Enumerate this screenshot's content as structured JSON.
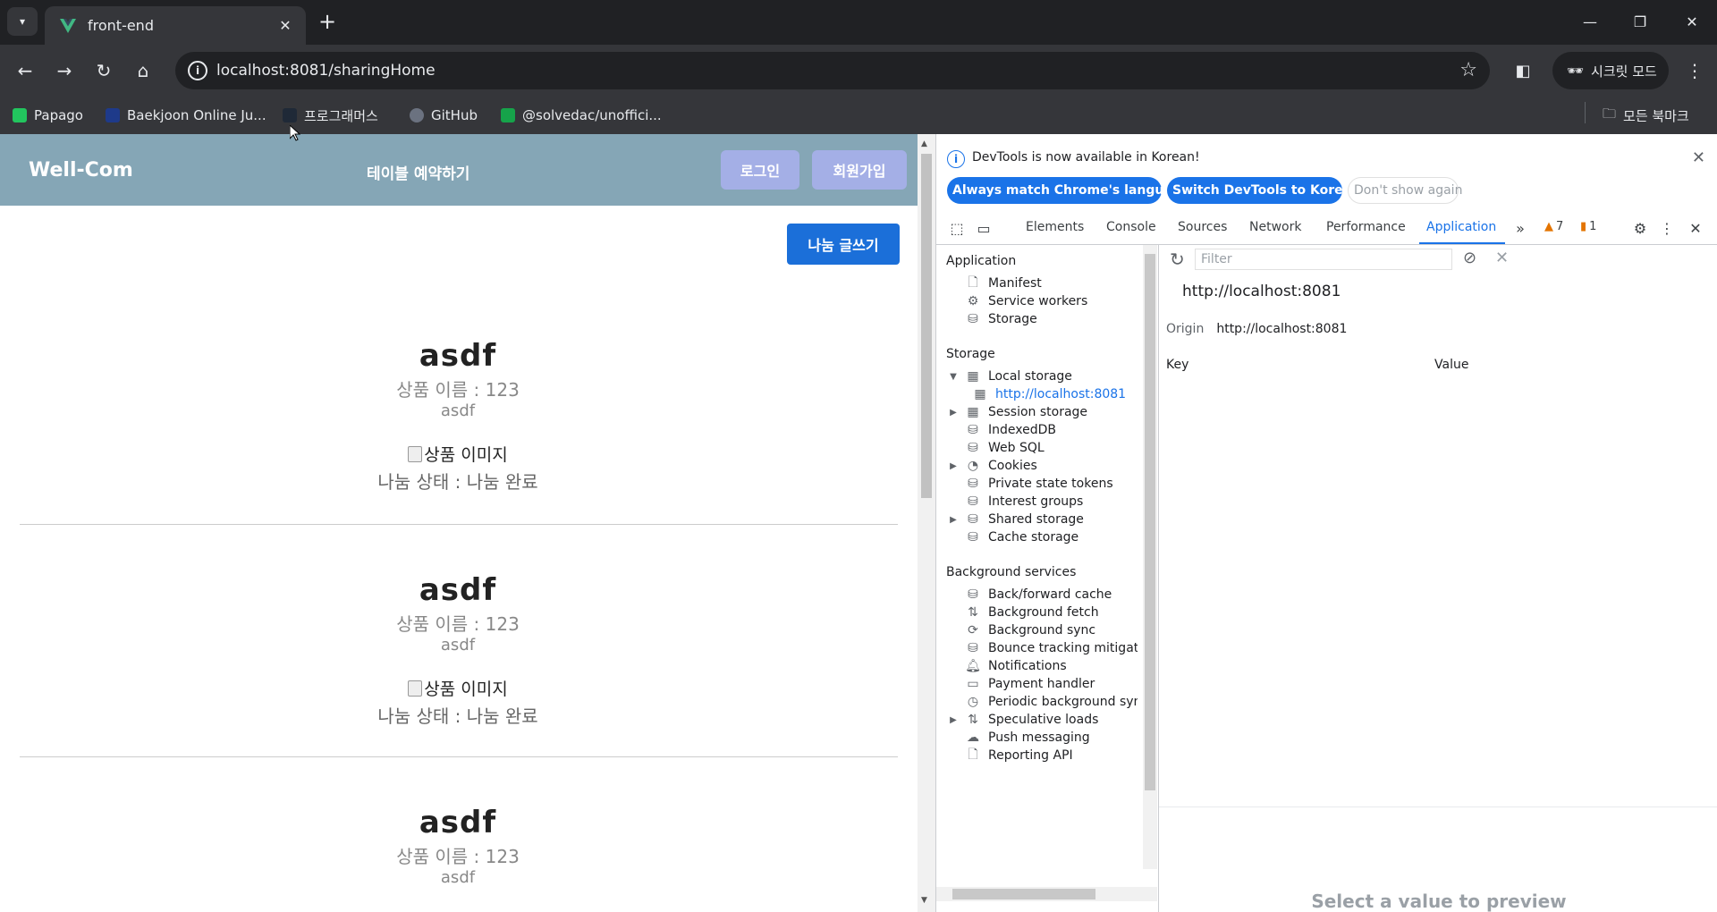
{
  "browser": {
    "tab_title": "front-end",
    "url": "localhost:8081/sharingHome",
    "incognito_label": "시크릿 모드",
    "bookmarks": [
      {
        "label": "Papago",
        "color": "#22c55e"
      },
      {
        "label": "Baekjoon Online Ju...",
        "color": "#1e3a8a"
      },
      {
        "label": "프로그래머스",
        "color": "#1f2937"
      },
      {
        "label": "GitHub",
        "color": "#6b7280"
      },
      {
        "label": "@solvedac/unoffici...",
        "color": "#16a34a"
      }
    ],
    "all_bookmarks_label": "모든 북마크"
  },
  "site": {
    "logo": "Well-Com",
    "nav_reserve": "테이블 예약하기",
    "login": "로그인",
    "signup": "회원가입",
    "write": "나눔 글쓰기",
    "posts": [
      {
        "title": "asdf",
        "name": "상품 이름 : 123",
        "desc": "asdf",
        "img_alt": "상품 이미지",
        "state": "나눔 상태 : 나눔 완료"
      },
      {
        "title": "asdf",
        "name": "상품 이름 : 123",
        "desc": "asdf",
        "img_alt": "상품 이미지",
        "state": "나눔 상태 : 나눔 완료"
      },
      {
        "title": "asdf",
        "name": "상품 이름 : 123",
        "desc": "asdf"
      }
    ]
  },
  "devtools": {
    "info_message": "DevTools is now available in Korean!",
    "btn_match": "Always match Chrome's language",
    "btn_switch": "Switch DevTools to Korean",
    "btn_dont_show": "Don't show again",
    "tabs": [
      "Elements",
      "Console",
      "Sources",
      "Network",
      "Performance",
      "Application"
    ],
    "active_tab": "Application",
    "warnings_count": "7",
    "issues_count": "1",
    "sidebar": {
      "application_header": "Application",
      "application_items": [
        "Manifest",
        "Service workers",
        "Storage"
      ],
      "storage_header": "Storage",
      "storage_items": [
        "Local storage",
        "http://localhost:8081",
        "Session storage",
        "IndexedDB",
        "Web SQL",
        "Cookies",
        "Private state tokens",
        "Interest groups",
        "Shared storage",
        "Cache storage"
      ],
      "background_header": "Background services",
      "background_items": [
        "Back/forward cache",
        "Background fetch",
        "Background sync",
        "Bounce tracking mitigatic",
        "Notifications",
        "Payment handler",
        "Periodic background sync",
        "Speculative loads",
        "Push messaging",
        "Reporting API"
      ]
    },
    "filter_placeholder": "Filter",
    "origin_title": "http://localhost:8081",
    "origin_label": "Origin",
    "origin_value": "http://localhost:8081",
    "col_key": "Key",
    "col_value": "Value",
    "preview_text": "Select a value to preview"
  }
}
